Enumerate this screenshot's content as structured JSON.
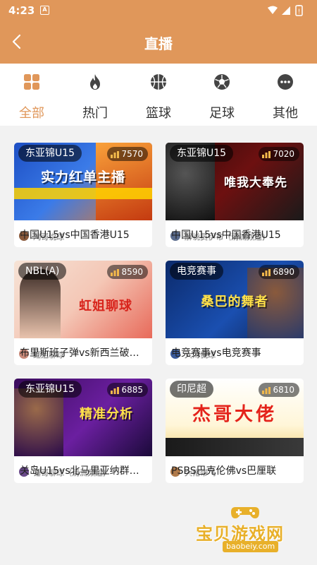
{
  "status_bar": {
    "time": "4:23",
    "notification_letter": "A"
  },
  "header": {
    "title": "直播"
  },
  "tabs": [
    {
      "label": "全部",
      "icon": "grid-icon",
      "active": true
    },
    {
      "label": "热门",
      "icon": "flame-icon",
      "active": false
    },
    {
      "label": "篮球",
      "icon": "basketball-icon",
      "active": false
    },
    {
      "label": "足球",
      "icon": "football-icon",
      "active": false
    },
    {
      "label": "其他",
      "icon": "more-icon",
      "active": false
    }
  ],
  "streams": [
    {
      "league": "东亚锦U15",
      "viewers": "7570",
      "thumb_text": "实力红单主播",
      "streamer": "鸿哥说球",
      "title": "中国U15vs中国香港U15"
    },
    {
      "league": "东亚锦U15",
      "viewers": "7020",
      "thumb_text": "唯我大奉先",
      "streamer": "解说员伊布（清流频道)",
      "title": "中国U15vs中国香港U15"
    },
    {
      "league": "NBL(A)",
      "viewers": "8590",
      "thumb_text": "虹姐聊球",
      "streamer": "虹姐聊球",
      "title": "布里斯班子弹vs新西兰破…"
    },
    {
      "league": "电竞赛事",
      "viewers": "6890",
      "thumb_text": "桑巴的舞者",
      "streamer": "大海侃球",
      "title": "电竞赛事vs电竞赛事"
    },
    {
      "league": "东亚锦U15",
      "viewers": "6885",
      "thumb_text": "精准分析",
      "streamer": "锤哥聊球（清流频道)",
      "title": "关岛U15vs北马里亚纳群…"
    },
    {
      "league": "印尼超",
      "viewers": "6810",
      "thumb_text": "杰哥大佬",
      "streamer": "大佬带飞",
      "title": "PSBS巴克伦佛vs巴厘联"
    }
  ],
  "watermark": {
    "title": "宝贝游戏网",
    "url": "baobeiy.com"
  },
  "colors": {
    "accent": "#e0975a",
    "background": "#f2f2f2"
  }
}
